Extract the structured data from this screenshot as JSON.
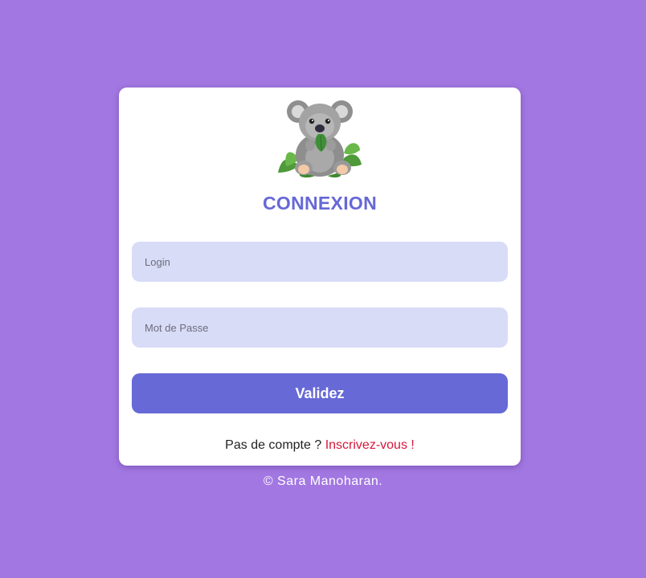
{
  "page": {
    "background_color": "#a277e1",
    "accent_color": "#6769d6",
    "link_color": "#d6163a"
  },
  "logo": {
    "icon": "koala-icon"
  },
  "form": {
    "title": "CONNEXION",
    "login_placeholder": "Login",
    "login_value": "",
    "password_placeholder": "Mot de Passe",
    "password_value": "",
    "submit_label": "Validez"
  },
  "signup": {
    "prompt": "Pas de compte ? ",
    "link_label": "Inscrivez-vous !"
  },
  "footer": {
    "copyright": "© Sara Manoharan."
  }
}
